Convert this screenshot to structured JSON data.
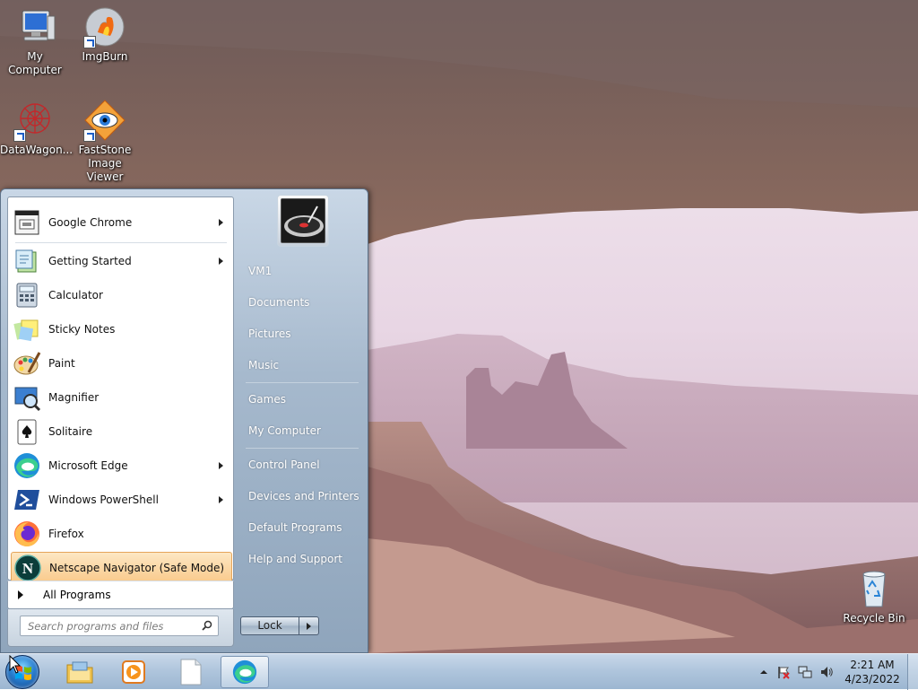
{
  "desktop": {
    "icons": [
      {
        "label": "My Computer",
        "icon": "computer-icon"
      },
      {
        "label": "ImgBurn",
        "icon": "disc-burn-icon"
      },
      {
        "label": "DataWagon...",
        "icon": "datawagon-icon"
      },
      {
        "label": "FastStone Image Viewer",
        "icon": "eye-icon"
      },
      {
        "label": "Recycle Bin",
        "icon": "recycle-bin-icon"
      }
    ]
  },
  "start_menu": {
    "programs": [
      {
        "label": "Google Chrome",
        "icon": "chrome-icon",
        "submenu": true
      },
      {
        "label": "Getting Started",
        "icon": "getting-started-icon",
        "submenu": true
      },
      {
        "label": "Calculator",
        "icon": "calculator-icon",
        "submenu": false
      },
      {
        "label": "Sticky Notes",
        "icon": "sticky-notes-icon",
        "submenu": false
      },
      {
        "label": "Paint",
        "icon": "paint-icon",
        "submenu": false
      },
      {
        "label": "Magnifier",
        "icon": "magnifier-icon",
        "submenu": false
      },
      {
        "label": "Solitaire",
        "icon": "solitaire-icon",
        "submenu": false
      },
      {
        "label": "Microsoft Edge",
        "icon": "edge-icon",
        "submenu": true
      },
      {
        "label": "Windows PowerShell",
        "icon": "powershell-icon",
        "submenu": true
      },
      {
        "label": "Firefox",
        "icon": "firefox-icon",
        "submenu": false
      },
      {
        "label": "Netscape Navigator (Safe Mode)",
        "icon": "netscape-icon",
        "submenu": false,
        "highlighted": true
      }
    ],
    "all_programs_label": "All Programs",
    "search_placeholder": "Search programs and files",
    "right_items": [
      {
        "label": "VM1"
      },
      {
        "label": "Documents"
      },
      {
        "label": "Pictures"
      },
      {
        "label": "Music"
      },
      {
        "label": "Games"
      },
      {
        "label": "My Computer"
      },
      {
        "label": "Control Panel"
      },
      {
        "label": "Devices and Printers"
      },
      {
        "label": "Default Programs"
      },
      {
        "label": "Help and Support"
      }
    ],
    "lock_label": "Lock"
  },
  "taskbar": {
    "pinned": [
      "file-explorer-icon",
      "media-player-icon",
      "notepad-icon",
      "edge-icon"
    ],
    "tray_icons": [
      "show-hidden-icons-chevron",
      "action-center-flag-icon",
      "network-icon",
      "volume-icon"
    ],
    "time": "2:21 AM",
    "date": "4/23/2022"
  },
  "colors": {
    "highlight": "#f9c98a",
    "menu_right_pane": "#8fa5bc",
    "taskbar": "#b0c6dd"
  }
}
